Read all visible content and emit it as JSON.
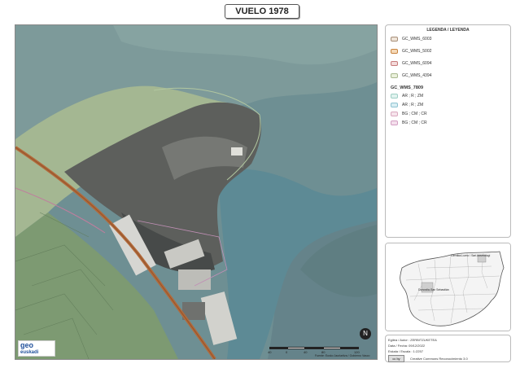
{
  "title": "VUELO 1978",
  "map": {
    "logo_main": "geo",
    "logo_sub": "euskadi",
    "north_symbol": "N",
    "scale_labels": [
      "40",
      "0",
      "40",
      "80",
      "120"
    ],
    "credit": "Fuente: Eusko Jaurlaritza / Gobierno Vasco"
  },
  "legend": {
    "title": "LEGENDA / LEYENDA",
    "layers": [
      {
        "label": "GC_WMS_6003",
        "color": "#c9b7a6"
      },
      {
        "label": "GC_WMS_5002",
        "color": "#d99a5a"
      },
      {
        "label": "GC_WMS_6094",
        "color": "#d39c9c"
      },
      {
        "label": "GC_WMS_4394",
        "color": "#cbd7b8"
      }
    ],
    "group_title": "GC_WMS_7809",
    "group_items": [
      {
        "label": "AR ; R ; ZM",
        "color": "#bfe3dc"
      },
      {
        "label": "AR ; R ; ZM",
        "color": "#a9d6e0"
      },
      {
        "label": "BG ; CM ; CR",
        "color": "#e9c9d7"
      },
      {
        "label": "BG ; CM ; CR",
        "color": "#e6c2d9"
      }
    ]
  },
  "inset": {
    "label_1": "Gernika-Lumo / Sari-kosmologi",
    "label_2": "Donostia-San Sebastián"
  },
  "info": {
    "author": "Egilea / Autor : ZERBITZUKETEA",
    "date": "Data / Fecha: 09/12/2022",
    "scale": "Eskala / Escala : 1:2257",
    "license_badge": "cc by",
    "license": "Creative Commons Reconocimiento 3.0"
  }
}
